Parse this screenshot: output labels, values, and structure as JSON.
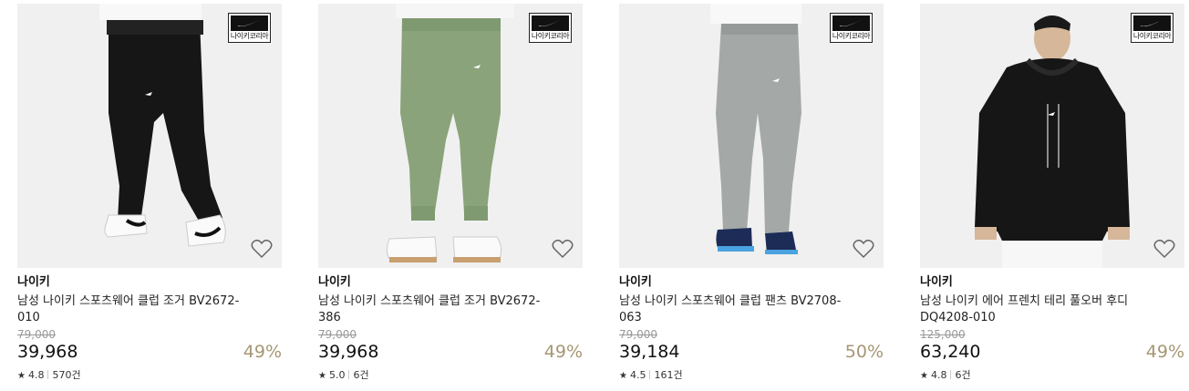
{
  "colors": {
    "discount": "#a59773",
    "thumb_bg": "#f1f1f1",
    "badge_bg": "#111111"
  },
  "products": [
    {
      "badge": "나이키코리아",
      "brand": "나이키",
      "title": "남성 나이키 스포츠웨어 클럽 조거 BV2672-010",
      "original_price": "79,000",
      "price": "39,968",
      "discount": "49%",
      "rating": "4.8",
      "reviews": "570건",
      "icon": "heart-outline-icon"
    },
    {
      "badge": "나이키코리아",
      "brand": "나이키",
      "title": "남성 나이키 스포츠웨어 클럽 조거 BV2672-386",
      "original_price": "79,000",
      "price": "39,968",
      "discount": "49%",
      "rating": "5.0",
      "reviews": "6건",
      "icon": "heart-outline-icon"
    },
    {
      "badge": "나이키코리아",
      "brand": "나이키",
      "title": "남성 나이키 스포츠웨어 클럽 팬츠 BV2708-063",
      "original_price": "79,000",
      "price": "39,184",
      "discount": "50%",
      "rating": "4.5",
      "reviews": "161건",
      "icon": "heart-outline-icon"
    },
    {
      "badge": "나이키코리아",
      "brand": "나이키",
      "title": "남성 나이키 에어 프렌치 테리 풀오버 후디 DQ4208-010",
      "original_price": "125,000",
      "price": "63,240",
      "discount": "49%",
      "rating": "4.8",
      "reviews": "6건",
      "icon": "heart-outline-icon"
    }
  ]
}
